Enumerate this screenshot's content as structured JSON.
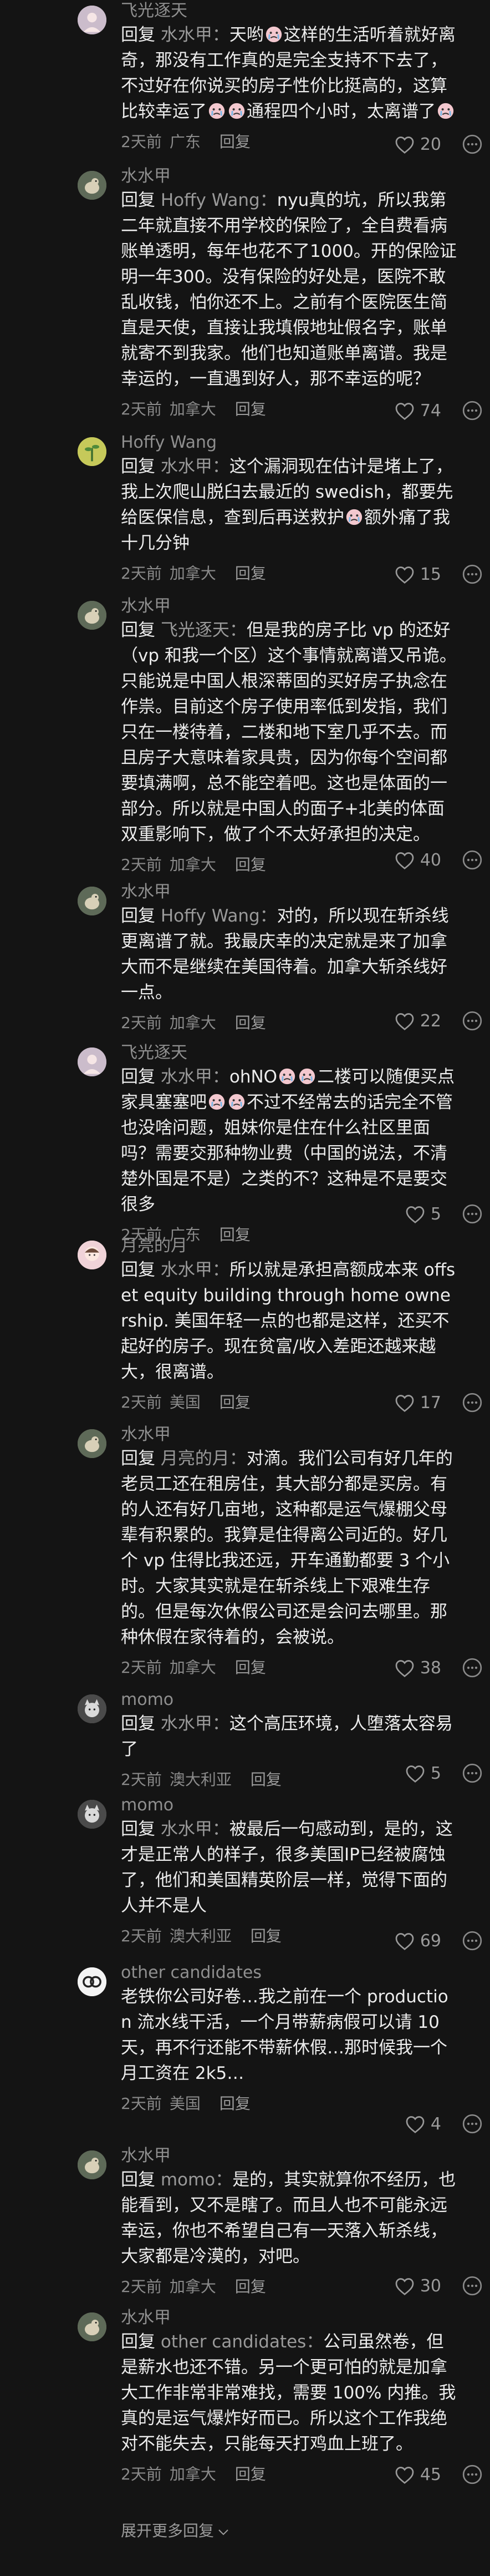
{
  "reply_word": "回复",
  "reply_button": "回复",
  "expand_more": "展开更多回复",
  "comments": [
    {
      "username": "飞光逐天",
      "avatar_color": "#c8b6c8",
      "avatar_icon": "portrait",
      "reply_to": "水水甲",
      "text": "天哟😭这样的生活听着就好离奇，那没有工作真的是完全支持不下去了，不过好在你说买的房子性价比挺高的，这算比较幸运了😭😭通程四个小时，太离谱了😭",
      "time": "2天前",
      "location": "广东",
      "likes": "20"
    },
    {
      "username": "水水甲",
      "avatar_color": "#7a7a6e",
      "avatar_icon": "bird",
      "reply_to": "Hoffy Wang",
      "text": "nyu真的坑，所以我第二年就直接不用学校的保险了，全自费看病账单透明，每年也花不了1000。开的保险证明一年300。没有保险的好处是，医院不敢乱收钱，怕你还不上。之前有个医院医生简直是天使，直接让我填假地址假名字，账单就寄不到我家。他们也知道账单离谱。我是幸运的，一直遇到好人，那不幸运的呢？",
      "time": "2天前",
      "location": "加拿大",
      "likes": "74"
    },
    {
      "username": "Hoffy Wang",
      "avatar_color": "#b0b84e",
      "avatar_icon": "plant",
      "reply_to": "水水甲",
      "text": "这个漏洞现在估计是堵上了，我上次爬山脱臼去最近的 swedish，都要先给医保信息，查到后再送救护😭额外痛了我十几分钟",
      "time": "2天前",
      "location": "加拿大",
      "likes": "15"
    },
    {
      "username": "水水甲",
      "avatar_color": "#7a7a6e",
      "avatar_icon": "bird",
      "reply_to": "飞光逐天",
      "text": "但是我的房子比 vp 的还好（vp 和我一个区）这个事情就离谱又吊诡。只能说是中国人根深蒂固的买好房子执念在作祟。目前这个房子使用率低到发指，我们只在一楼待着，二楼和地下室几乎不去。而且房子大意味着家具贵，因为你每个空间都要填满啊，总不能空着吧。这也是体面的一部分。所以就是中国人的面子+北美的体面双重影响下，做了个不太好承担的决定。",
      "time": "2天前",
      "location": "加拿大",
      "likes": "40"
    },
    {
      "username": "水水甲",
      "avatar_color": "#7a7a6e",
      "avatar_icon": "bird",
      "reply_to": "Hoffy Wang",
      "text": "对的，所以现在斩杀线更离谱了就。我最庆幸的决定就是来了加拿大而不是继续在美国待着。加拿大斩杀线好一点。",
      "time": "2天前",
      "location": "加拿大",
      "likes": "22"
    },
    {
      "username": "飞光逐天",
      "avatar_color": "#c8b6c8",
      "avatar_icon": "portrait",
      "reply_to": "水水甲",
      "text": "ohNO😭😭二楼可以随便买点家具塞塞吧😭😭不过不经常去的话完全不管也没啥问题，姐妹你是住在什么社区里面吗？需要交那种物业费（中国的说法，不清楚外国是不是）之类的不？这种是不是要交很多",
      "time": "2天前",
      "location": "广东",
      "likes": "5"
    },
    {
      "username": "月亮的月",
      "avatar_color": "#e8c4cc",
      "avatar_icon": "girl",
      "reply_to": "水水甲",
      "text": "所以就是承担高额成本来 offset equity building through home ownership. 美国年轻一点的也都是这样，还买不起好的房子。现在贫富/收入差距还越来越大，很离谱。",
      "time": "2天前",
      "location": "美国",
      "likes": "17"
    },
    {
      "username": "水水甲",
      "avatar_color": "#7a7a6e",
      "avatar_icon": "bird",
      "reply_to": "月亮的月",
      "text": "对滴。我们公司有好几年的老员工还在租房住，其大部分都是买房。有的人还有好几亩地，这种都是运气爆棚父母辈有积累的。我算是住得离公司近的。好几个 vp 住得比我还远，开车通勤都要 3 个小时。大家其实就是在斩杀线上下艰难生存的。但是每次休假公司还是会问去哪里。那种休假在家待着的，会被说。",
      "time": "2天前",
      "location": "加拿大",
      "likes": "38"
    },
    {
      "username": "momo",
      "avatar_color": "#6a6a6a",
      "avatar_icon": "cat",
      "reply_to": "水水甲",
      "text": "这个高压环境，人堕落太容易了",
      "time": "2天前",
      "location": "澳大利亚",
      "likes": "5"
    },
    {
      "username": "momo",
      "avatar_color": "#6a6a6a",
      "avatar_icon": "cat",
      "reply_to": "水水甲",
      "text": "被最后一句感动到，是的，这才是正常人的样子，很多美国IP已经被腐蚀了，他们和美国精英阶层一样，觉得下面的人并不是人",
      "time": "2天前",
      "location": "澳大利亚",
      "likes": "69"
    },
    {
      "username": "other candidates",
      "avatar_color": "#f2f2f2",
      "avatar_icon": "logo",
      "reply_to": "",
      "text": "老铁你公司好卷…我之前在一个 production 流水线干活，一个月带薪病假可以请 10 天，再不行还能不带薪休假…那时候我一个月工资在 2k5…",
      "time": "2天前",
      "location": "美国",
      "likes": "4"
    },
    {
      "username": "水水甲",
      "avatar_color": "#7a7a6e",
      "avatar_icon": "bird",
      "reply_to": "momo",
      "text": "是的，其实就算你不经历，也能看到，又不是瞎了。而且人也不可能永远幸运，你也不希望自己有一天落入斩杀线，大家都是冷漠的，对吧。",
      "time": "2天前",
      "location": "加拿大",
      "likes": "30"
    },
    {
      "username": "水水甲",
      "avatar_color": "#7a7a6e",
      "avatar_icon": "bird",
      "reply_to": "other candidates",
      "text": "公司虽然卷，但是薪水也还不错。另一个更可怕的就是加拿大工作非常非常难找，需要 100% 内推。我真的是运气爆炸好而已。所以这个工作我绝对不能失去，只能每天打鸡血上班了。",
      "time": "2天前",
      "location": "加拿大",
      "likes": "45"
    }
  ]
}
